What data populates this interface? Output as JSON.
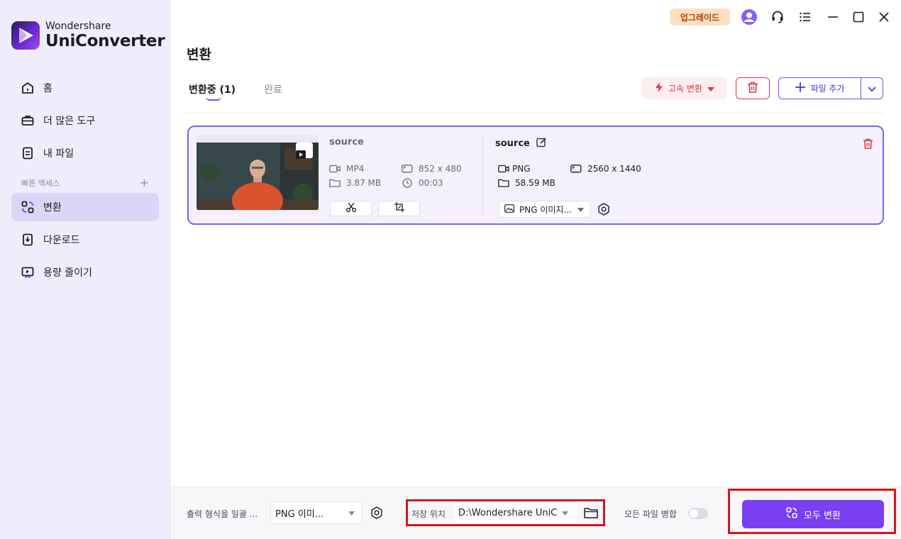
{
  "app": {
    "brand": "Wondershare",
    "product": "UniConverter"
  },
  "sidebar": {
    "items": [
      {
        "label": "홈",
        "icon": "home-icon"
      },
      {
        "label": "더 많은 도구",
        "icon": "toolbox-icon"
      },
      {
        "label": "내 파일",
        "icon": "file-icon"
      }
    ],
    "quick_access_label": "빠른 액세스",
    "quick_items": [
      {
        "label": "변환",
        "icon": "convert-icon",
        "active": true
      },
      {
        "label": "다운로드",
        "icon": "download-icon"
      },
      {
        "label": "용량 줄이기",
        "icon": "compress-icon"
      }
    ]
  },
  "topbar": {
    "upgrade_label": "업그레이드"
  },
  "page": {
    "title": "변환"
  },
  "tabs": {
    "converting_label": "변환중",
    "converting_count": "(1)",
    "done_label": "완료"
  },
  "toolbar": {
    "fast_convert_label": "고속 변환",
    "add_file_label": "파일 추가"
  },
  "file": {
    "source": {
      "name": "source",
      "format": "MP4",
      "resolution": "852 x 480",
      "size": "3.87 MB",
      "duration": "00:03"
    },
    "output": {
      "name": "source",
      "format": "PNG",
      "resolution": "2560 x 1440",
      "size": "58.59 MB",
      "format_select": "PNG 이미지..."
    }
  },
  "bottom": {
    "output_format_label": "출력 형식을 일괄 ...",
    "output_format_value": "PNG 이미...",
    "save_label": "저장 위치",
    "save_path": "D:\\Wondershare UniConverter",
    "merge_label": "모든 파일 병합",
    "convert_all_label": "모두 변환"
  },
  "colors": {
    "accent": "#7a3ff0",
    "danger": "#e5334b",
    "highlight_box": "#d7141b"
  }
}
